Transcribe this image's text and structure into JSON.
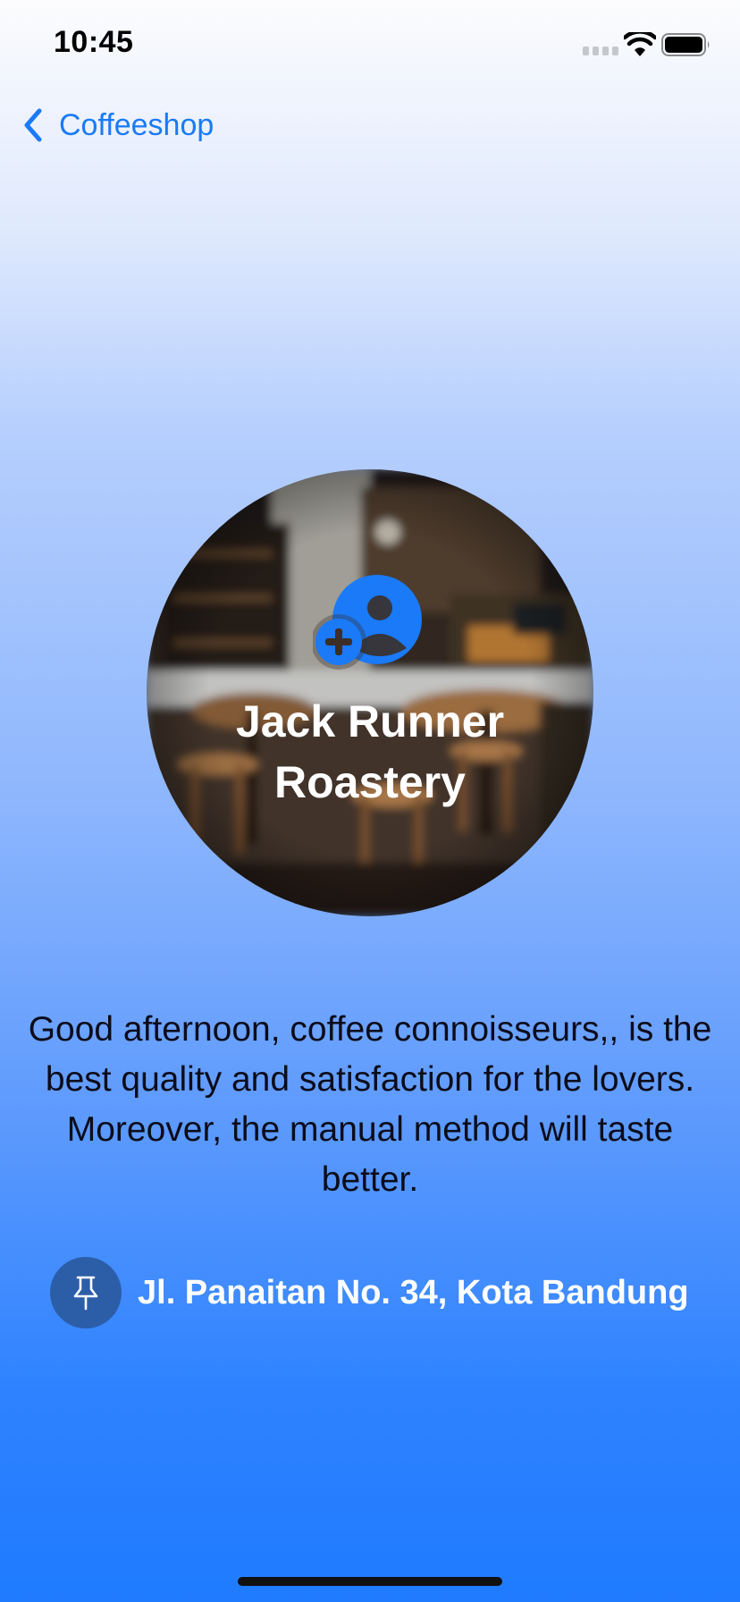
{
  "status_bar": {
    "time": "10:45",
    "icons": [
      "cellular-signal-icon",
      "wifi-icon",
      "battery-icon"
    ]
  },
  "nav": {
    "back_label": "Coffeeshop",
    "back_icon": "chevron-left-icon"
  },
  "shop": {
    "name": "Jack Runner Roastery",
    "hero_icon": "add-person-icon",
    "description": "Good afternoon, coffee connoisseurs,, is the best quality and satisfaction for the lovers. Moreover, the manual method will taste better.",
    "address": "Jl. Panaitan No. 34, Kota Bandung",
    "address_icon": "pin-icon"
  },
  "colors": {
    "accent": "#1a7af8",
    "pin_badge": "#2c5ea8",
    "text_dark": "#0c0c1a"
  }
}
